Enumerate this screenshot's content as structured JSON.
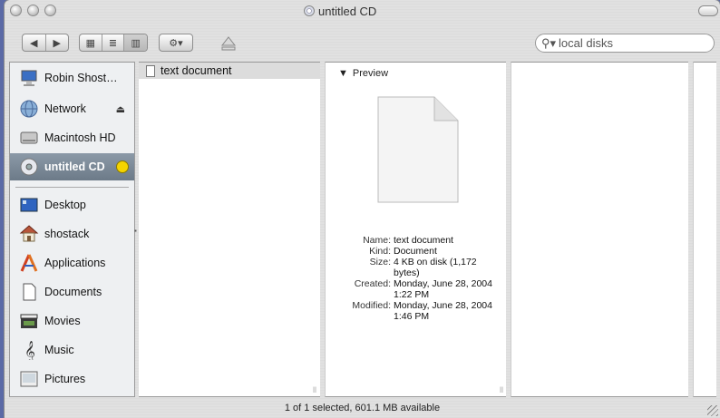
{
  "window": {
    "title": "untitled CD"
  },
  "toolbar": {
    "back_label": "◀",
    "forward_label": "▶",
    "view_icon": "▦",
    "view_list": "≣",
    "view_column": "▥",
    "action_label": "⚙▾"
  },
  "search": {
    "value": "local disks",
    "placeholder": ""
  },
  "sidebar": {
    "devices": [
      {
        "label": "Robin Shost…",
        "icon": "computer-icon"
      },
      {
        "label": "Network",
        "icon": "network-globe-icon"
      },
      {
        "label": "Macintosh HD",
        "icon": "hard-disk-icon"
      },
      {
        "label": "untitled CD",
        "icon": "cd-icon"
      }
    ],
    "places": [
      {
        "label": "Desktop",
        "icon": "desktop-icon"
      },
      {
        "label": "shostack",
        "icon": "home-icon"
      },
      {
        "label": "Applications",
        "icon": "applications-icon"
      },
      {
        "label": "Documents",
        "icon": "documents-icon"
      },
      {
        "label": "Movies",
        "icon": "movies-icon"
      },
      {
        "label": "Music",
        "icon": "music-icon"
      },
      {
        "label": "Pictures",
        "icon": "pictures-icon"
      }
    ]
  },
  "files": [
    {
      "name": "text document"
    }
  ],
  "preview": {
    "heading": "Preview",
    "info": [
      {
        "label": "Name:",
        "value": "text document"
      },
      {
        "label": "Kind:",
        "value": "Document"
      },
      {
        "label": "Size:",
        "value": "4 KB on disk (1,172 bytes)"
      },
      {
        "label": "Created:",
        "value": "Monday, June 28, 2004 1:22 PM"
      },
      {
        "label": "Modified:",
        "value": "Monday, June 28, 2004 1:46 PM"
      }
    ]
  },
  "status": {
    "text": "1 of 1 selected, 601.1 MB available"
  }
}
